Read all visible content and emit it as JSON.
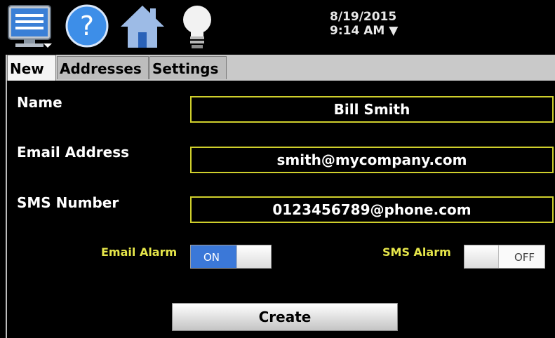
{
  "header": {
    "date": "8/19/2015",
    "time": "9:14 AM ▼",
    "icons": [
      "monitor-menu-icon",
      "help-icon",
      "home-icon",
      "lightbulb-icon"
    ]
  },
  "tabs": [
    {
      "label": "New",
      "active": true
    },
    {
      "label": "Addresses",
      "active": false
    },
    {
      "label": "Settings",
      "active": false
    }
  ],
  "form": {
    "name_label": "Name",
    "name_value": "Bill Smith",
    "email_label": "Email Address",
    "email_value": "smith@mycompany.com",
    "sms_label": "SMS Number",
    "sms_value": "0123456789@phone.com",
    "email_alarm_label": "Email Alarm",
    "email_alarm_state": "ON",
    "sms_alarm_label": "SMS Alarm",
    "sms_alarm_state": "OFF",
    "create_label": "Create"
  },
  "colors": {
    "field_border": "#cfcf2c",
    "alarm_label": "#e6e64a",
    "toggle_on": "#3b78d8"
  }
}
